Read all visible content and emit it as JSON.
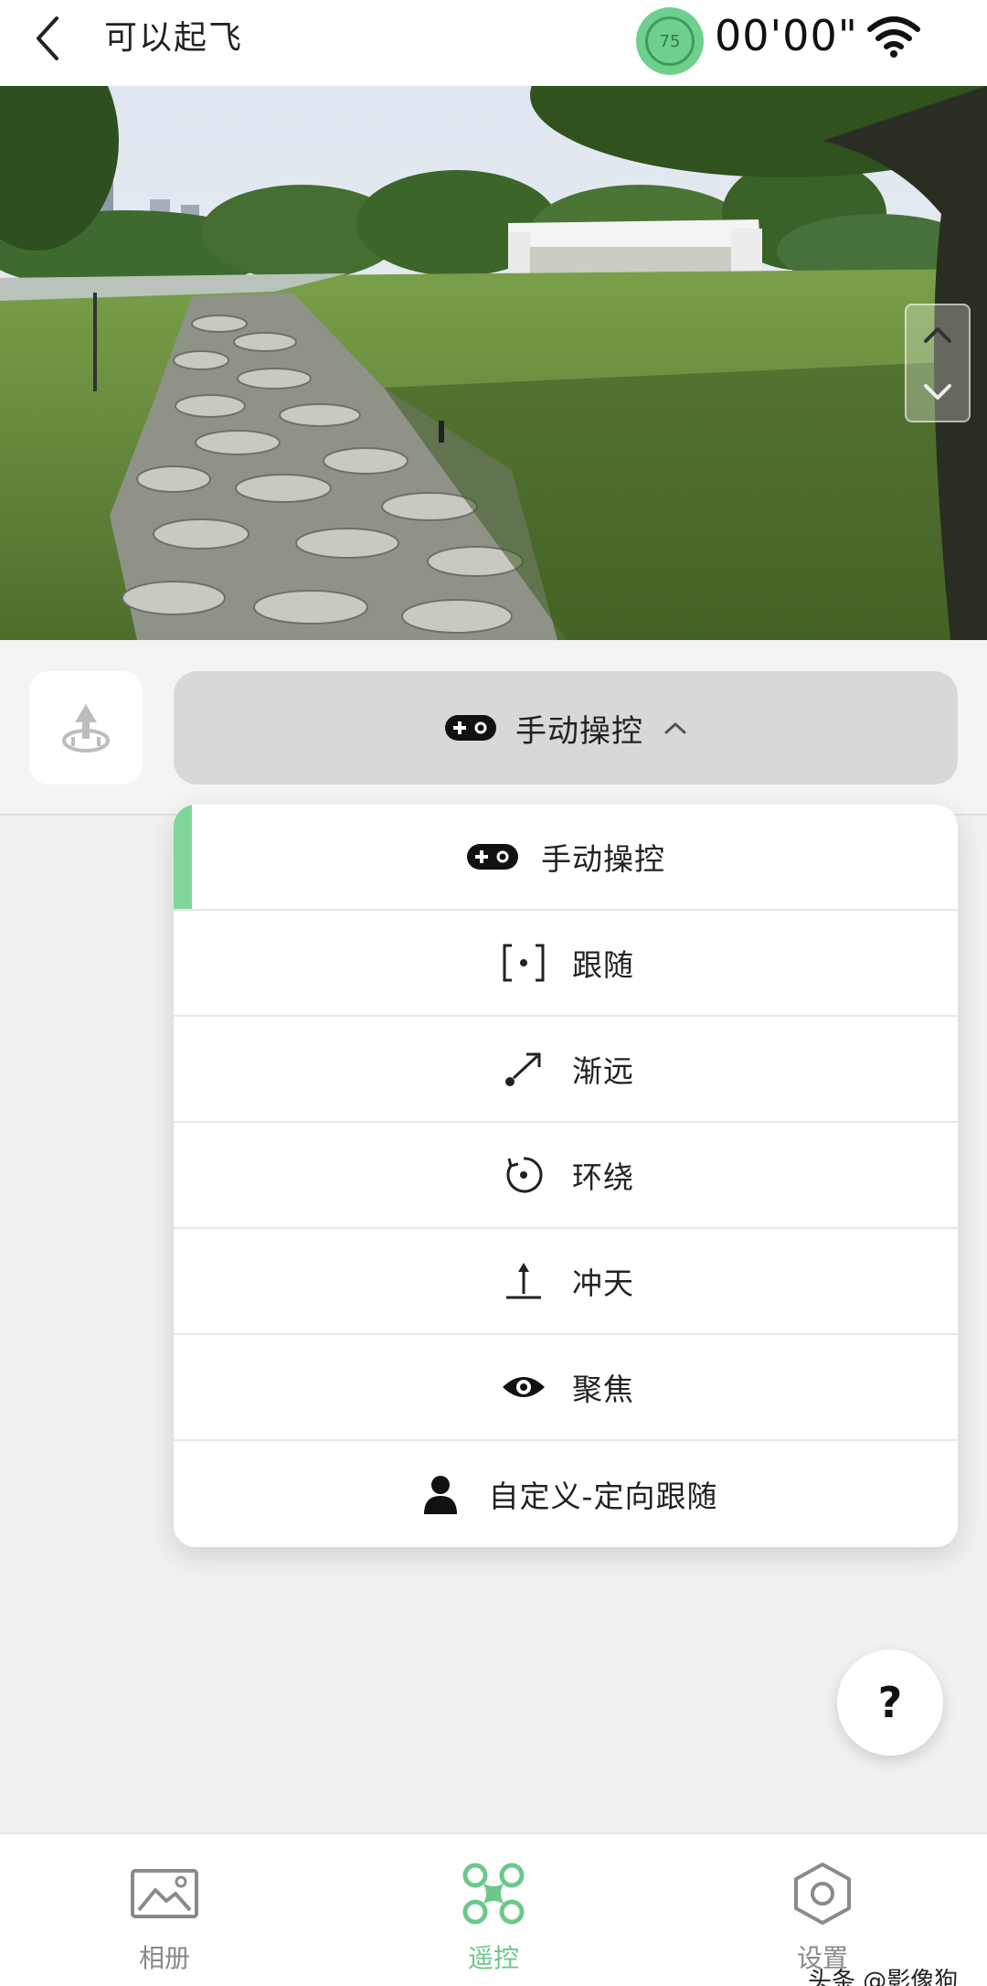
{
  "header": {
    "title": "可以起飞",
    "battery_percent": "75",
    "flight_time": "00'00\"",
    "back_icon": "chevron-left-icon",
    "wifi_icon": "wifi-icon"
  },
  "camera": {
    "gimbal_up_icon": "chevron-up-icon",
    "gimbal_down_icon": "chevron-down-icon"
  },
  "control": {
    "takeoff_icon": "takeoff-icon",
    "mode_selector_label": "手动操控",
    "mode_selector_icon": "gamepad-icon",
    "expanded_icon": "chevron-up-icon"
  },
  "mode_menu": {
    "items": [
      {
        "label": "手动操控",
        "icon": "gamepad-icon",
        "selected": true
      },
      {
        "label": "跟随",
        "icon": "focus-frame-icon",
        "selected": false
      },
      {
        "label": "渐远",
        "icon": "diagonal-arrow-icon",
        "selected": false
      },
      {
        "label": "环绕",
        "icon": "orbit-icon",
        "selected": false
      },
      {
        "label": "冲天",
        "icon": "rocket-up-icon",
        "selected": false
      },
      {
        "label": "聚焦",
        "icon": "eye-icon",
        "selected": false
      },
      {
        "label": "自定义-定向跟随",
        "icon": "person-icon",
        "selected": false
      }
    ]
  },
  "help": {
    "label": "?"
  },
  "nav": {
    "items": [
      {
        "label": "相册",
        "icon": "gallery-icon",
        "active": false
      },
      {
        "label": "遥控",
        "icon": "drone-icon",
        "active": true
      },
      {
        "label": "设置",
        "icon": "hexagon-settings-icon",
        "active": false
      }
    ]
  },
  "watermark": "头条 @影像狗",
  "colors": {
    "accent": "#7ed69a",
    "battery": "#6fcf8d",
    "selector_bg": "#d8d8d8"
  }
}
